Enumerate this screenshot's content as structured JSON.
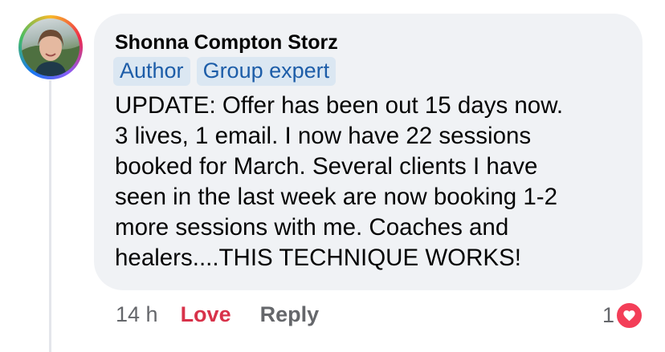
{
  "comment": {
    "author_name": "Shonna Compton Storz",
    "badges": [
      "Author",
      "Group expert"
    ],
    "text_lines": [
      "UPDATE: Offer has been out 15 days now.",
      "3 lives, 1 email. I now have 22 sessions",
      "booked for March. Several clients I have",
      "seen in the last week are now booking 1-2",
      "more sessions with me. Coaches and",
      "healers....THIS TECHNIQUE WORKS!"
    ],
    "timestamp": "14 h",
    "love_label": "Love",
    "reply_label": "Reply",
    "reaction_count": "1",
    "reaction_icon": "heart-icon"
  },
  "colors": {
    "bubble_bg": "#f0f2f5",
    "badge_bg": "#dbe7f2",
    "badge_text": "#1d5da8",
    "love": "#d8324a",
    "heart": "#f33e58",
    "meta_text": "#65676b"
  }
}
